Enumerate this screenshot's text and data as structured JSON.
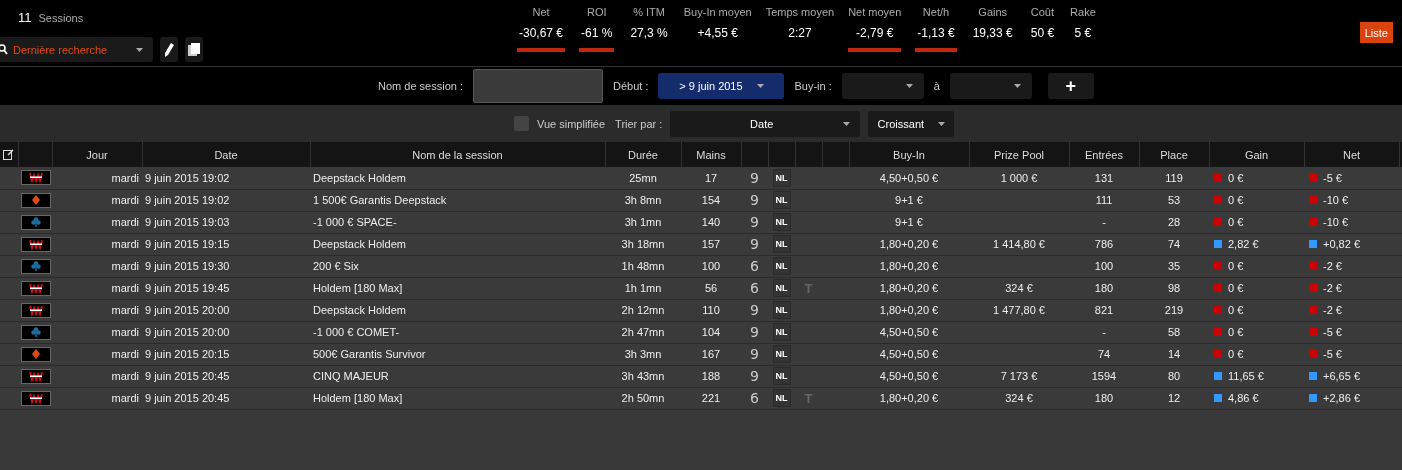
{
  "summary": {
    "count": "11",
    "label": "Sessions"
  },
  "saved_search": {
    "value": "Dernière recherche"
  },
  "stats": [
    {
      "label": "Net",
      "value": "-30,67 €",
      "negative": true
    },
    {
      "label": "ROI",
      "value": "-61 %",
      "negative": true
    },
    {
      "label": "% ITM",
      "value": "27,3 %",
      "negative": false
    },
    {
      "label": "Buy-In moyen",
      "value": "+4,55 €",
      "negative": false
    },
    {
      "label": "Temps moyen",
      "value": "2:27",
      "negative": false
    },
    {
      "label": "Net moyen",
      "value": "-2,79 €",
      "negative": true
    },
    {
      "label": "Net/h",
      "value": "-1,13 €",
      "negative": true
    },
    {
      "label": "Gains",
      "value": "19,33 €",
      "negative": false
    },
    {
      "label": "Coût",
      "value": "50 €",
      "negative": false
    },
    {
      "label": "Rake",
      "value": "5 €",
      "negative": false
    }
  ],
  "view_button": "Liste",
  "filters": {
    "session_label": "Nom de session :",
    "start_label": "Début :",
    "start_value": "> 9 juin 2015",
    "buyin_label": "Buy-in :",
    "to_label": "à",
    "add_button": "+"
  },
  "options": {
    "simplified": {
      "label": "Vue simplifiée",
      "checked": false
    },
    "sort_label": "Trier par :",
    "sort_value": "Date",
    "order_value": "Croissant"
  },
  "table": {
    "columns": [
      "Jour",
      "Date",
      "Nom de la session",
      "Durée",
      "Mains",
      "Buy-In",
      "Prize Pool",
      "Entrées",
      "Place",
      "Gain",
      "Net"
    ],
    "rows": [
      {
        "kind": "w",
        "day": "mardi",
        "date": "9 juin 2015 19:02",
        "name": "Deepstack Holdem",
        "duration": "25mn",
        "hands": "17",
        "players": "9",
        "limit": "NL",
        "buyin": "4,50+0,50 €",
        "prize_pool": "1 000 €",
        "entries": "131",
        "place": "119",
        "gain": "0 €",
        "net": "-5 €",
        "color": "#cc0000"
      },
      {
        "kind": "diamond",
        "day": "mardi",
        "date": "9 juin 2015 19:02",
        "name": "1 500€ Garantis Deepstack",
        "duration": "3h 8mn",
        "hands": "154",
        "players": "9",
        "limit": "NL",
        "buyin": "9+1 €",
        "entries": "111",
        "place": "53",
        "gain": "0 €",
        "net": "-10 €",
        "color": "#cc0000"
      },
      {
        "kind": "club",
        "day": "mardi",
        "date": "9 juin 2015 19:03",
        "name": "-1 000 € SPACE-",
        "duration": "3h 1mn",
        "hands": "140",
        "players": "9",
        "limit": "NL",
        "buyin": "9+1 €",
        "entries": "-",
        "place": "28",
        "gain": "0 €",
        "net": "-10 €",
        "color": "#cc0000"
      },
      {
        "kind": "w",
        "day": "mardi",
        "date": "9 juin 2015 19:15",
        "name": "Deepstack Holdem",
        "duration": "3h 18mn",
        "hands": "157",
        "players": "9",
        "limit": "NL",
        "buyin": "1,80+0,20 €",
        "prize_pool": "1 414,80 €",
        "entries": "786",
        "place": "74",
        "gain": "2,82 €",
        "net": "+0,82 €",
        "color": "#3399ff"
      },
      {
        "kind": "club",
        "day": "mardi",
        "date": "9 juin 2015 19:30",
        "name": "200 € Six",
        "duration": "1h 48mn",
        "hands": "100",
        "players": "6",
        "limit": "NL",
        "buyin": "1,80+0,20 €",
        "entries": "100",
        "place": "35",
        "gain": "0 €",
        "net": "-2 €",
        "color": "#cc0000"
      },
      {
        "kind": "w",
        "day": "mardi",
        "date": "9 juin 2015 19:45",
        "name": "Holdem [180 Max]",
        "duration": "1h 1mn",
        "hands": "56",
        "players": "6",
        "limit": "NL",
        "speed": "T",
        "buyin": "1,80+0,20 €",
        "prize_pool": "324 €",
        "entries": "180",
        "place": "98",
        "gain": "0 €",
        "net": "-2 €",
        "color": "#cc0000"
      },
      {
        "kind": "w",
        "day": "mardi",
        "date": "9 juin 2015 20:00",
        "name": "Deepstack Holdem",
        "duration": "2h 12mn",
        "hands": "110",
        "players": "9",
        "limit": "NL",
        "buyin": "1,80+0,20 €",
        "prize_pool": "1 477,80 €",
        "entries": "821",
        "place": "219",
        "gain": "0 €",
        "net": "-2 €",
        "color": "#cc0000"
      },
      {
        "kind": "club",
        "day": "mardi",
        "date": "9 juin 2015 20:00",
        "name": "-1 000 € COMET-",
        "duration": "2h 47mn",
        "hands": "104",
        "players": "9",
        "limit": "NL",
        "buyin": "4,50+0,50 €",
        "entries": "-",
        "place": "58",
        "gain": "0 €",
        "net": "-5 €",
        "color": "#cc0000"
      },
      {
        "kind": "diamond",
        "day": "mardi",
        "date": "9 juin 2015 20:15",
        "name": "500€ Garantis Survivor",
        "duration": "3h 3mn",
        "hands": "167",
        "players": "9",
        "limit": "NL",
        "buyin": "4,50+0,50 €",
        "entries": "74",
        "place": "14",
        "gain": "0 €",
        "net": "-5 €",
        "color": "#cc0000"
      },
      {
        "kind": "w",
        "day": "mardi",
        "date": "9 juin 2015 20:45",
        "name": "CINQ MAJEUR",
        "duration": "3h 43mn",
        "hands": "188",
        "players": "9",
        "limit": "NL",
        "buyin": "4,50+0,50 €",
        "prize_pool": "7 173 €",
        "entries": "1594",
        "place": "80",
        "gain": "11,65 €",
        "net": "+6,65 €",
        "color": "#3399ff"
      },
      {
        "kind": "w",
        "day": "mardi",
        "date": "9 juin 2015 20:45",
        "name": "Holdem [180 Max]",
        "duration": "2h 50mn",
        "hands": "221",
        "players": "6",
        "limit": "NL",
        "speed": "T",
        "buyin": "1,80+0,20 €",
        "prize_pool": "324 €",
        "entries": "180",
        "place": "12",
        "gain": "4,86 €",
        "net": "+2,86 €",
        "color": "#3399ff"
      }
    ]
  }
}
